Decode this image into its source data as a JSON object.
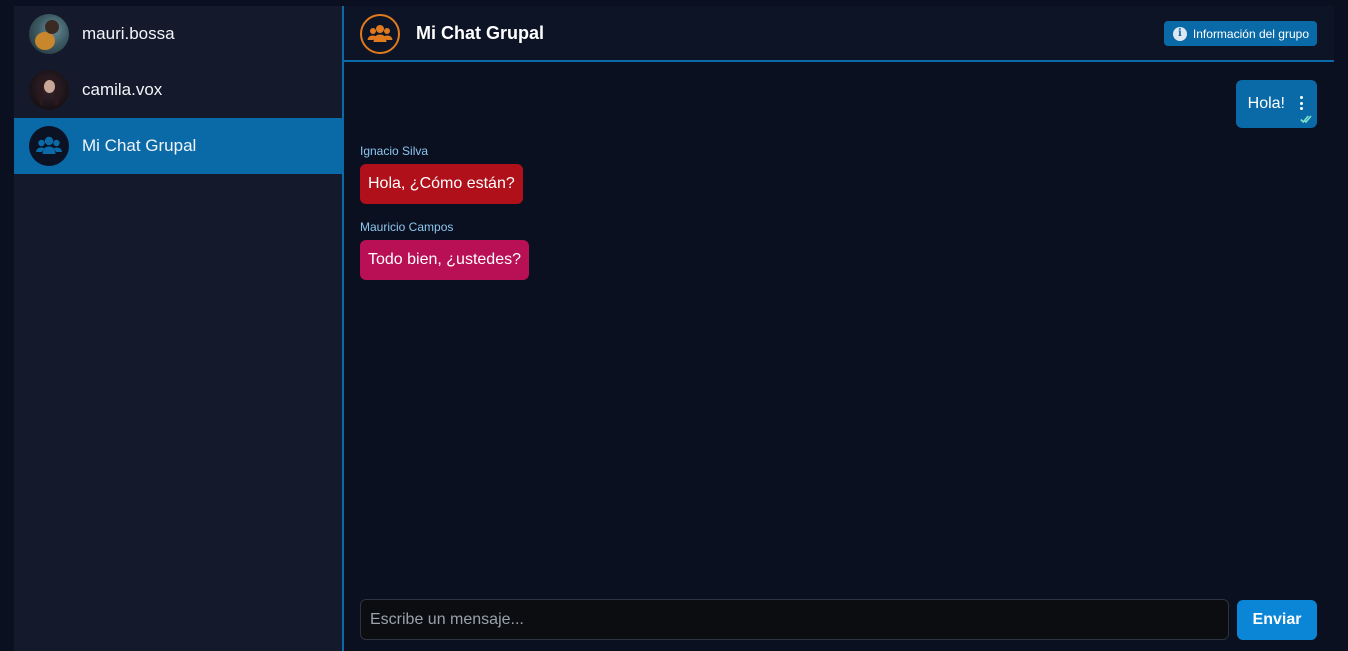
{
  "sidebar": {
    "contacts": [
      {
        "name": "mauri.bossa",
        "avatar": "user-photo"
      },
      {
        "name": "camila.vox",
        "avatar": "user-photo"
      },
      {
        "name": "Mi Chat Grupal",
        "avatar": "group-icon",
        "active": true
      }
    ]
  },
  "chat": {
    "title": "Mi Chat Grupal",
    "header_icon": "group-icon",
    "info_button_label": "Información del grupo",
    "info_icon": "info-icon",
    "messages": [
      {
        "own": true,
        "text": "Hola!",
        "status": "double-check-icon"
      },
      {
        "sender": "Ignacio Silva",
        "text": "Hola, ¿Cómo están?",
        "color": "#b0101a"
      },
      {
        "sender": "Mauricio Campos",
        "text": "Todo bien, ¿ustedes?",
        "color": "#b80f55"
      }
    ],
    "composer": {
      "placeholder": "Escribe un mensaje...",
      "value": ""
    },
    "send_label": "Enviar"
  },
  "colors": {
    "accent": "#0a6aa8",
    "send": "#0b86d6",
    "group_avatar_ring": "#e07a1f",
    "sender_name": "#8ec6f0"
  }
}
